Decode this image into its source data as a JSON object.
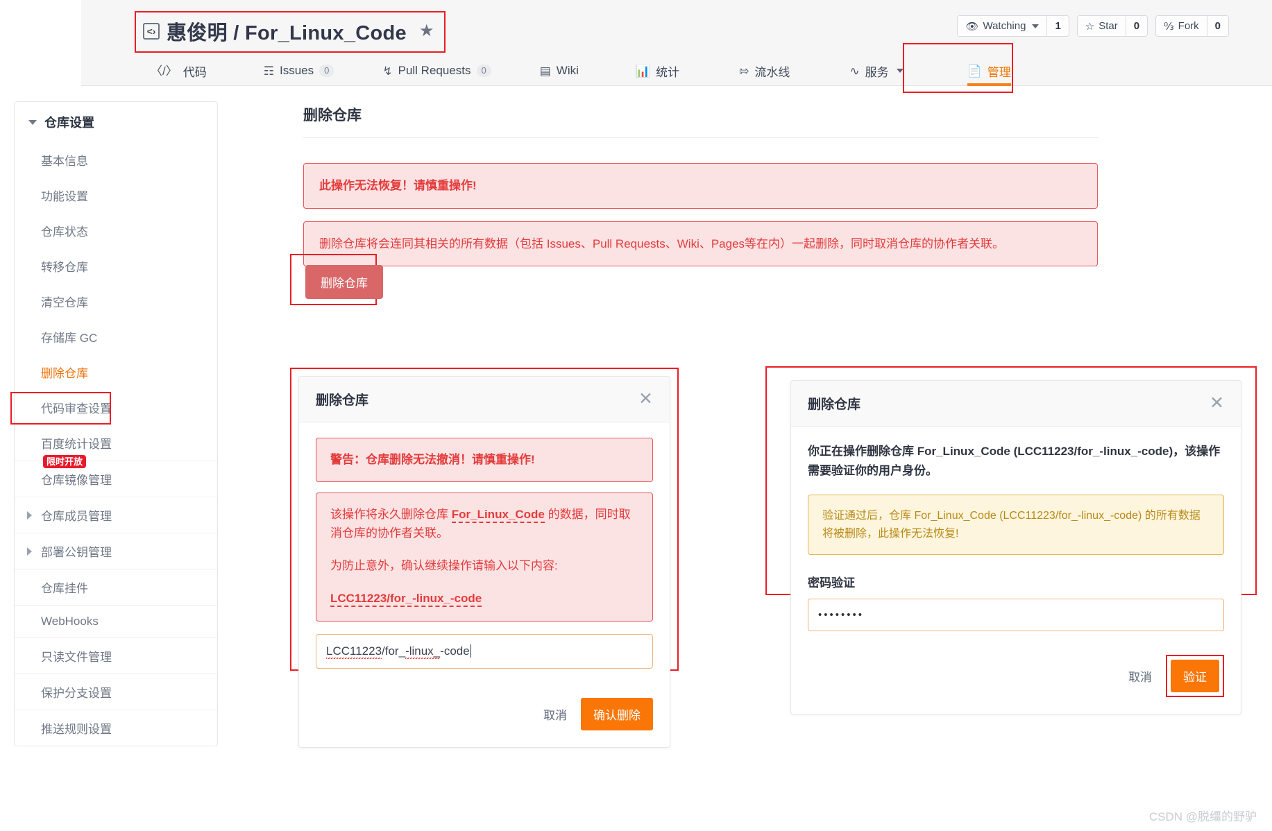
{
  "header": {
    "repo_owner_and_name": "惠俊明 / For_Linux_Code",
    "repo_icon": "code-brackets-icon",
    "medal_icon": "medal-badge-icon",
    "actions": [
      {
        "label": "Watching",
        "count": "1",
        "icon": "eye-icon",
        "has_caret": true
      },
      {
        "label": "Star",
        "count": "0",
        "icon": "star-icon",
        "has_caret": false
      },
      {
        "label": "Fork",
        "count": "0",
        "icon": "fork-icon",
        "has_caret": false
      }
    ]
  },
  "nav": {
    "tabs": [
      {
        "label": "代码",
        "icon": "code-icon",
        "count": null,
        "active": false,
        "caret": false
      },
      {
        "label": "Issues",
        "icon": "issues-icon",
        "count": "0",
        "active": false,
        "caret": false
      },
      {
        "label": "Pull Requests",
        "icon": "pull-request-icon",
        "count": "0",
        "active": false,
        "caret": false
      },
      {
        "label": "Wiki",
        "icon": "wiki-book-icon",
        "count": null,
        "active": false,
        "caret": false
      },
      {
        "label": "统计",
        "icon": "chart-bar-icon",
        "count": null,
        "active": false,
        "caret": false
      },
      {
        "label": "流水线",
        "icon": "pipeline-icon",
        "count": null,
        "active": false,
        "caret": false
      },
      {
        "label": "服务",
        "icon": "pulse-icon",
        "count": null,
        "active": false,
        "caret": true
      },
      {
        "label": "管理",
        "icon": "manage-doc-icon",
        "count": null,
        "active": true,
        "caret": false
      }
    ]
  },
  "sidebar": {
    "title": "仓库设置",
    "items": [
      {
        "label": "基本信息",
        "active": false,
        "expandable": false,
        "badge": null,
        "separator": false
      },
      {
        "label": "功能设置",
        "active": false,
        "expandable": false,
        "badge": null,
        "separator": false
      },
      {
        "label": "仓库状态",
        "active": false,
        "expandable": false,
        "badge": null,
        "separator": false
      },
      {
        "label": "转移仓库",
        "active": false,
        "expandable": false,
        "badge": null,
        "separator": false
      },
      {
        "label": "清空仓库",
        "active": false,
        "expandable": false,
        "badge": null,
        "separator": false
      },
      {
        "label": "存储库 GC",
        "active": false,
        "expandable": false,
        "badge": null,
        "separator": false
      },
      {
        "label": "删除仓库",
        "active": true,
        "expandable": false,
        "badge": null,
        "separator": false
      },
      {
        "label": "代码审查设置",
        "active": false,
        "expandable": false,
        "badge": null,
        "separator": false
      },
      {
        "label": "百度统计设置",
        "active": false,
        "expandable": false,
        "badge": null,
        "separator": false
      },
      {
        "label": "仓库镜像管理",
        "active": false,
        "expandable": false,
        "badge": "限时开放",
        "separator": true
      },
      {
        "label": "仓库成员管理",
        "active": false,
        "expandable": true,
        "badge": null,
        "separator": true
      },
      {
        "label": "部署公钥管理",
        "active": false,
        "expandable": true,
        "badge": null,
        "separator": true
      },
      {
        "label": "仓库挂件",
        "active": false,
        "expandable": false,
        "badge": null,
        "separator": true
      },
      {
        "label": "WebHooks",
        "active": false,
        "expandable": false,
        "badge": null,
        "separator": true
      },
      {
        "label": "只读文件管理",
        "active": false,
        "expandable": false,
        "badge": null,
        "separator": true
      },
      {
        "label": "保护分支设置",
        "active": false,
        "expandable": false,
        "badge": null,
        "separator": true
      },
      {
        "label": "推送规则设置",
        "active": false,
        "expandable": false,
        "badge": null,
        "separator": true
      }
    ]
  },
  "main": {
    "title": "删除仓库",
    "alert_irreversible": "此操作无法恢复！请慎重操作!",
    "alert_detail": "删除仓库将会连同其相关的所有数据（包括 Issues、Pull Requests、Wiki、Pages等在内）一起删除，同时取消仓库的协作者关联。",
    "delete_button": "删除仓库"
  },
  "modal_confirm": {
    "title": "删除仓库",
    "close_icon": "close-x-icon",
    "warning": "警告：仓库删除无法撤消！请慎重操作!",
    "desc_prefix": "该操作将永久删除仓库 ",
    "desc_repo": "For_Linux_Code",
    "desc_suffix": " 的数据，同时取消仓库的协作者关联。",
    "instruction": "为防止意外，确认继续操作请输入以下内容:",
    "required_text": "LCC11223/for_-linux_-code",
    "input_value_part1": "LCC11223",
    "input_value_part2": "/for_",
    "input_value_part3": "-linux_",
    "input_value_part4": "-code",
    "cancel_label": "取消",
    "confirm_label": "确认删除"
  },
  "modal_verify": {
    "title": "删除仓库",
    "close_icon": "close-x-icon",
    "desc": "你正在操作删除仓库 For_Linux_Code (LCC11223/for_-linux_-code)，该操作需要验证你的用户身份。",
    "yellow_note": "验证通过后，仓库 For_Linux_Code (LCC11223/for_-linux_-code) 的所有数据将被删除，此操作无法恢复!",
    "password_label": "密码验证",
    "password_value": "••••••••",
    "cancel_label": "取消",
    "verify_label": "验证"
  },
  "watermark": "CSDN @脱缰的野驴",
  "colors": {
    "accent_orange": "#f58220",
    "danger_red": "#e33b3b",
    "annotation_red": "#ec1c24",
    "badge_red": "#e8192c",
    "warn_yellow_border": "#e4b657"
  }
}
